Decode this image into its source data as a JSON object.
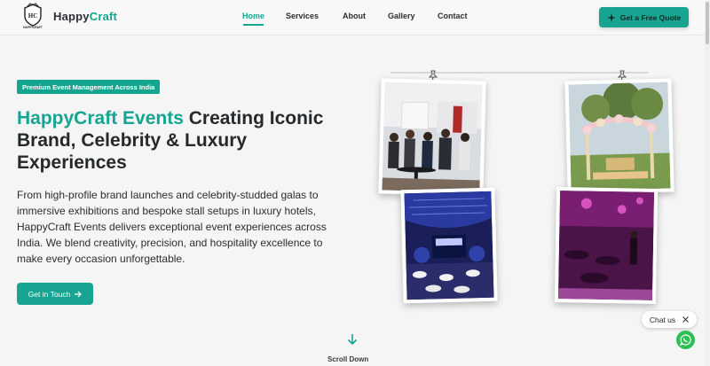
{
  "nav": {
    "logo_text": "HC",
    "logo_caption": "HAPPYCRAFT",
    "brand_part1": "Happy",
    "brand_part2": "Craft",
    "links": [
      "Home",
      "Services",
      "About",
      "Gallery",
      "Contact"
    ],
    "active": "Home",
    "cta_label": "Get a Free Quote"
  },
  "hero": {
    "badge": "Premium Event Management Across India",
    "headline_accent": "HappyCraft Events",
    "headline_rest": " Creating Iconic Brand, Celebrity & Luxury Experiences",
    "description": "From high-profile brand launches and celebrity-studded galas to immersive exhibitions and bespoke stall setups in luxury hotels, HappyCraft Events delivers exceptional event experiences across India. We blend creativity, precision, and hospitality excellence to make every occasion unforgettable.",
    "cta_label": "Get in Touch",
    "scroll_label": "Scroll Down"
  },
  "gallery": {
    "photos": [
      "corporate-networking-event",
      "floral-mandap-outdoor",
      "stage-concert-lights",
      "purple-lit-gala-dinner"
    ]
  },
  "chat": {
    "label": "Chat us"
  },
  "colors": {
    "accent": "#17a592",
    "text": "#25292c",
    "background": "#f4f5f4"
  }
}
